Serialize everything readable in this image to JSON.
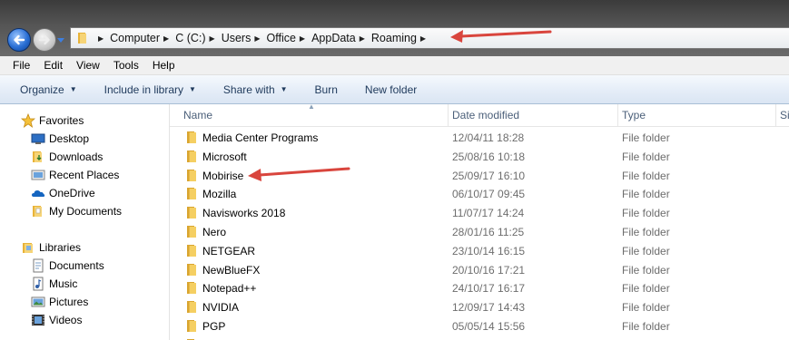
{
  "address": {
    "breadcrumbs": [
      "Computer",
      "C (C:)",
      "Users",
      "Office",
      "AppData",
      "Roaming"
    ]
  },
  "menu": [
    "File",
    "Edit",
    "View",
    "Tools",
    "Help"
  ],
  "commands": {
    "organize": "Organize",
    "include_in_library": "Include in library",
    "share_with": "Share with",
    "burn": "Burn",
    "new_folder": "New folder"
  },
  "nav": {
    "favorites": {
      "label": "Favorites",
      "items": [
        {
          "label": "Desktop",
          "icon": "desktop-icon"
        },
        {
          "label": "Downloads",
          "icon": "downloads-folder-icon"
        },
        {
          "label": "Recent Places",
          "icon": "recent-places-icon"
        },
        {
          "label": "OneDrive",
          "icon": "onedrive-cloud-icon"
        },
        {
          "label": "My Documents",
          "icon": "documents-folder-icon"
        }
      ]
    },
    "libraries": {
      "label": "Libraries",
      "items": [
        {
          "label": "Documents",
          "icon": "documents-library-icon"
        },
        {
          "label": "Music",
          "icon": "music-library-icon"
        },
        {
          "label": "Pictures",
          "icon": "pictures-library-icon"
        },
        {
          "label": "Videos",
          "icon": "videos-library-icon"
        }
      ]
    }
  },
  "columns": {
    "name": "Name",
    "date": "Date modified",
    "type": "Type",
    "size": "Si"
  },
  "files": [
    {
      "name": "Media Center Programs",
      "date": "12/04/11 18:28",
      "type": "File folder"
    },
    {
      "name": "Microsoft",
      "date": "25/08/16 10:18",
      "type": "File folder"
    },
    {
      "name": "Mobirise",
      "date": "25/09/17 16:10",
      "type": "File folder"
    },
    {
      "name": "Mozilla",
      "date": "06/10/17 09:45",
      "type": "File folder"
    },
    {
      "name": "Navisworks 2018",
      "date": "11/07/17 14:24",
      "type": "File folder"
    },
    {
      "name": "Nero",
      "date": "28/01/16 11:25",
      "type": "File folder"
    },
    {
      "name": "NETGEAR",
      "date": "23/10/14 16:15",
      "type": "File folder"
    },
    {
      "name": "NewBlueFX",
      "date": "20/10/16 17:21",
      "type": "File folder"
    },
    {
      "name": "Notepad++",
      "date": "24/10/17 16:17",
      "type": "File folder"
    },
    {
      "name": "NVIDIA",
      "date": "12/09/17 14:43",
      "type": "File folder"
    },
    {
      "name": "PGP",
      "date": "05/05/14 15:56",
      "type": "File folder"
    },
    {
      "name": "",
      "date": "",
      "type": ""
    }
  ],
  "colors": {
    "annotation_arrow": "#d9453d",
    "folder": "#f2c64a",
    "command_text": "#1e395b"
  }
}
